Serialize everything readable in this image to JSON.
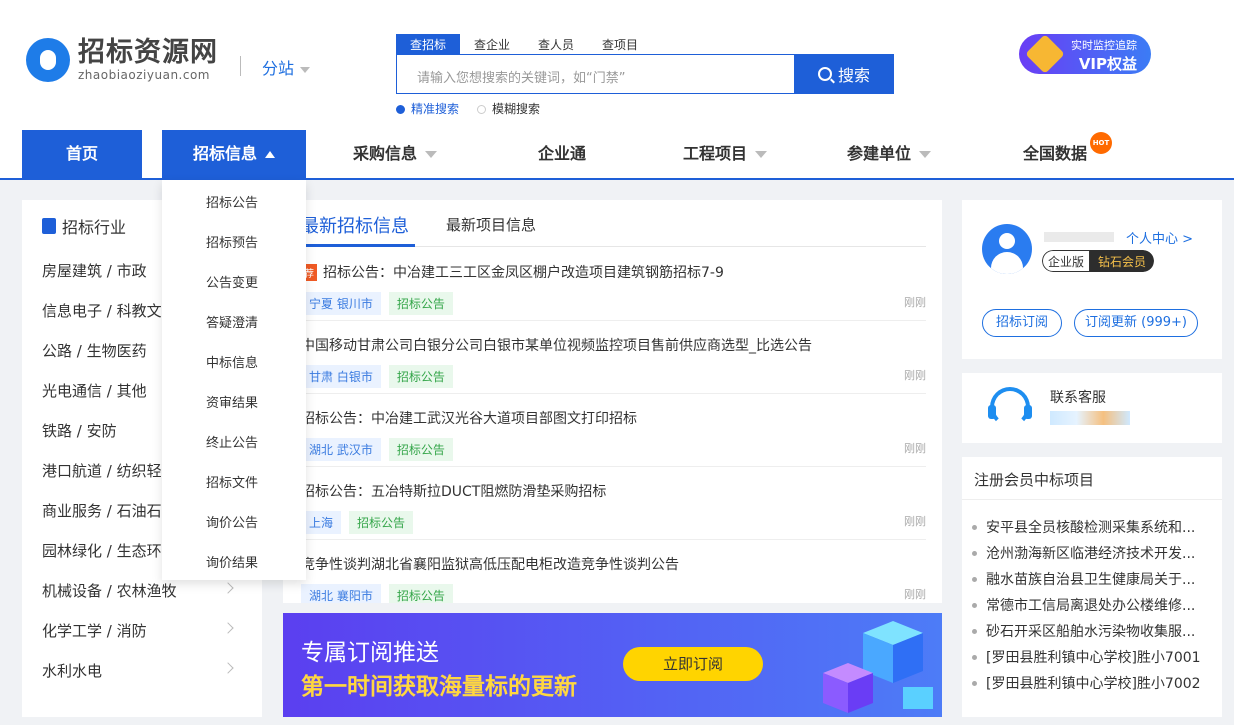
{
  "logo": {
    "cn": "招标资源网",
    "en": "zhaobiaoziyuan.com"
  },
  "site_switch": "分站",
  "search": {
    "tabs": [
      "查招标",
      "查企业",
      "查人员",
      "查项目"
    ],
    "placeholder": "请输入您想搜索的关键词，如“门禁”",
    "button": "搜索",
    "modes": [
      "精准搜索",
      "模糊搜索"
    ]
  },
  "vip": {
    "top": "实时监控追踪",
    "main": "VIP权益"
  },
  "nav": [
    "首页",
    "招标信息",
    "采购信息",
    "企业通",
    "工程项目",
    "参建单位",
    "全国数据"
  ],
  "hot_badge": "HOT",
  "dropdown": [
    "招标公告",
    "招标预告",
    "公告变更",
    "答疑澄清",
    "中标信息",
    "资审结果",
    "终止公告",
    "招标文件",
    "询价公告",
    "询价结果"
  ],
  "industry": {
    "title": "招标行业",
    "items": [
      "房屋建筑 / 市政",
      "信息电子 / 科教文",
      "公路 / 生物医药",
      "光电通信 / 其他",
      "铁路 / 安防",
      "港口航道 / 纺织轻工",
      "商业服务 / 石油石化",
      "园林绿化 / 生态环保",
      "机械设备 / 农林渔牧",
      "化学工学 / 消防",
      "水利水电"
    ]
  },
  "tabs": {
    "active": "最新招标信息",
    "other": "最新项目信息"
  },
  "tender_tag": "荐",
  "tenders": [
    {
      "title": "招标公告：中冶建工三工区金凤区棚户改造项目建筑钢筋招标7-9",
      "region": "宁夏 银川市",
      "category": "招标公告",
      "time": "刚刚"
    },
    {
      "title": "中国移动甘肃公司白银分公司白银市某单位视频监控项目售前供应商选型_比选公告",
      "region": "甘肃 白银市",
      "category": "招标公告",
      "time": "刚刚"
    },
    {
      "title": "招标公告：中冶建工武汉光谷大道项目部图文打印招标",
      "region": "湖北 武汉市",
      "category": "招标公告",
      "time": "刚刚"
    },
    {
      "title": "招标公告：五冶特斯拉DUCT阻燃防滑垫采购招标",
      "region": "上海",
      "category": "招标公告",
      "time": "刚刚"
    },
    {
      "title": "竞争性谈判湖北省襄阳监狱高低压配电柜改造竞争性谈判公告",
      "region": "湖北 襄阳市",
      "category": "招标公告",
      "time": "刚刚"
    }
  ],
  "banner": {
    "line1": "专属订阅推送",
    "line2": "第一时间获取海量标的更新",
    "button": "立即订阅"
  },
  "user": {
    "center": "个人中心 >",
    "badge_left": "企业版",
    "badge_right": "钻石会员",
    "btn1": "招标订阅",
    "btn2": "订阅更新 (999+)"
  },
  "service": {
    "title": "联系客服"
  },
  "winners": {
    "title": "注册会员中标项目",
    "items": [
      "安平县全员核酸检测采集系统和...",
      "沧州渤海新区临港经济技术开发...",
      "融水苗族自治县卫生健康局关于...",
      "常德市工信局离退处办公楼维修...",
      "砂石开采区船舶水污染物收集服...",
      "[罗田县胜利镇中心学校]胜小7001",
      "[罗田县胜利镇中心学校]胜小7002"
    ]
  },
  "colors": {
    "primary": "#1e5fd8",
    "region_tag": "#3a7be0",
    "category_tag": "#35a64a",
    "rec": "#f05a24"
  }
}
